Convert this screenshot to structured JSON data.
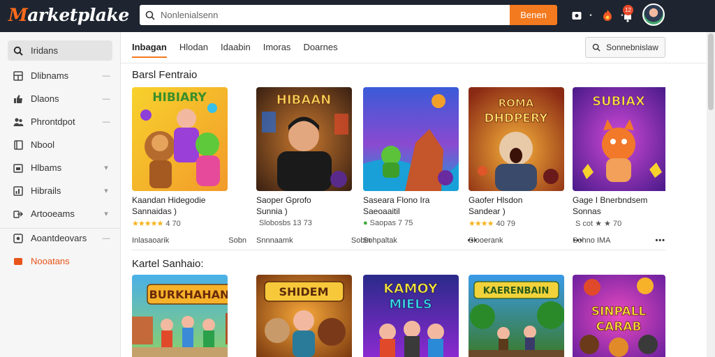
{
  "header": {
    "logo": "Marketplake",
    "search_placeholder": "Nonlenialsenn",
    "search_button": "Benen",
    "notification_count": "12"
  },
  "sidebar": {
    "items": [
      {
        "label": "Iridans",
        "icon": "search-icon",
        "chevron": ""
      },
      {
        "label": "Dlibnams",
        "icon": "grid-icon",
        "chevron": "—"
      },
      {
        "label": "Dlaons",
        "icon": "thumbs-up-icon",
        "chevron": "—"
      },
      {
        "label": "Phrontdpot",
        "icon": "people-icon",
        "chevron": "—"
      },
      {
        "label": "Nbool",
        "icon": "book-icon",
        "chevron": ""
      },
      {
        "label": "Hlbams",
        "icon": "box-icon",
        "chevron": "▾"
      },
      {
        "label": "Hibrails",
        "icon": "chart-icon",
        "chevron": "▾"
      },
      {
        "label": "Artooeams",
        "icon": "link-icon",
        "chevron": "▾"
      },
      {
        "label": "Aoantdeovars",
        "icon": "settings-icon",
        "chevron": "—"
      },
      {
        "label": "Nooatans",
        "icon": "tag-icon",
        "chevron": ""
      }
    ]
  },
  "tabs": [
    "Inbagan",
    "Hlodan",
    "Idaabin",
    "Imoras",
    "Doarnes"
  ],
  "sort_button": "Sonnebnislaw",
  "sections": {
    "first_title": "Barsl Fentraio",
    "second_title": "Kartel Sanhaio:"
  },
  "row1": [
    {
      "art": "HIBIARY",
      "title": "Kaandan Hidegodie",
      "subtitle": "Sannaidas )",
      "rating": "4  70",
      "stars": "★★★★★",
      "star_color": "gold",
      "foot_left": "Inlasaoarik",
      "foot_right": "Sobn",
      "more": ""
    },
    {
      "art": "HIBAAN",
      "title": "Saoper Gprofo",
      "subtitle": "Sunnia )",
      "rating": "Slobosbs  13  73",
      "stars": "",
      "star_color": "",
      "foot_left": "Snnnaamk",
      "foot_right": "Sobin",
      "more": ""
    },
    {
      "art": "",
      "title": "Saseara Flono Ira",
      "subtitle": "Saeoaaitil",
      "rating": "Saopas  7  75",
      "stars": "●",
      "star_color": "green",
      "foot_left": "Sohpaltak",
      "foot_right": "",
      "more": "•••"
    },
    {
      "art": "ROMA DHDPERY",
      "title": "Gaofer Hlsdon",
      "subtitle": "Sandear )",
      "rating": "40  79",
      "stars": "★★★★",
      "star_color": "gold",
      "foot_left": "Slooerank",
      "foot_right": "",
      "more": "•••"
    },
    {
      "art": "SUBIAX",
      "title": "Gage I Bnerbndsem",
      "subtitle": "Sonnas",
      "rating": "S cot  ★  ★  70",
      "stars": "",
      "star_color": "",
      "foot_left": "Sohno IMA",
      "foot_right": "",
      "more": "•••"
    }
  ],
  "row2": [
    {
      "art": "BURKHAHAN"
    },
    {
      "art": "SHIDEM"
    },
    {
      "art": "KAMOY MIELS"
    },
    {
      "art": "KAERENBAIN"
    },
    {
      "art": "SINPALL CARAB"
    }
  ]
}
